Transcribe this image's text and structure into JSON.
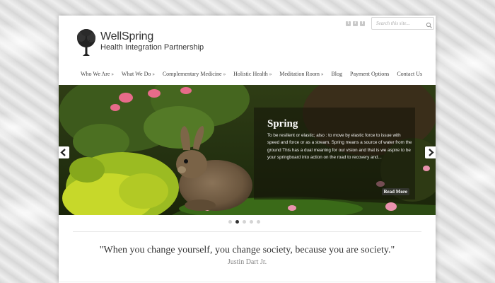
{
  "header": {
    "search_placeholder": "Search this site...",
    "social_icons": [
      "twitter-icon",
      "rss-icon",
      "facebook-icon"
    ],
    "brand": "WellSpring",
    "tagline": "Health Integration Partnership"
  },
  "nav": {
    "items": [
      {
        "label": "Who We Are",
        "submenu": "»"
      },
      {
        "label": "What We Do",
        "submenu": "»"
      },
      {
        "label": "Complementary Medicine",
        "submenu": "»"
      },
      {
        "label": "Holistic Health",
        "submenu": "»"
      },
      {
        "label": "Meditation Room",
        "submenu": "»"
      },
      {
        "label": "Blog",
        "submenu": ""
      },
      {
        "label": "Payment Options",
        "submenu": ""
      },
      {
        "label": "Contact Us",
        "submenu": ""
      }
    ]
  },
  "slider": {
    "title": "Spring",
    "text": "To be resilient or elastic; also : to move by elastic force to issue with speed and force or as a stream.  Spring means a source of water from the ground This has a dual meaning for our vision and that is we aspire to be your springboard into action on the road to recovery and...",
    "read_more": "Read More",
    "slide_count": 5,
    "active_slide": 2
  },
  "quote": {
    "text": "\"When you change yourself, you change society, because you are society.\"",
    "author": "Justin Dart Jr."
  },
  "colors": {
    "accent": "#333333",
    "caption_bg": "rgba(20,20,10,0.55)",
    "page_bg": "#ffffff"
  }
}
